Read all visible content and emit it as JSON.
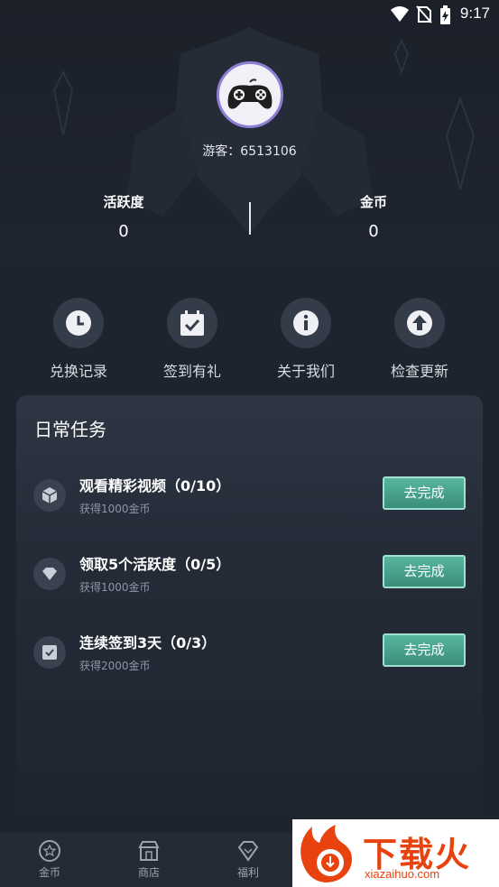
{
  "status_bar": {
    "time": "9:17",
    "icons": [
      "wifi-icon",
      "no-sim-icon",
      "battery-charging-icon"
    ]
  },
  "profile": {
    "avatar_icon": "gamepad-icon",
    "username": "游客：6513106"
  },
  "stats": {
    "activity_label": "活跃度",
    "activity_value": "0",
    "coins_label": "金币",
    "coins_value": "0"
  },
  "quick_actions": [
    {
      "label": "兑换记录",
      "icon": "clock-icon"
    },
    {
      "label": "签到有礼",
      "icon": "calendar-check-icon"
    },
    {
      "label": "关于我们",
      "icon": "info-icon"
    },
    {
      "label": "检查更新",
      "icon": "arrow-up-icon"
    }
  ],
  "daily_tasks": {
    "title": "日常任务",
    "button_label": "去完成",
    "items": [
      {
        "title": "观看精彩视频（0/10）",
        "reward": "获得1000金币",
        "icon": "cube-icon"
      },
      {
        "title": "领取5个活跃度（0/5）",
        "reward": "获得1000金币",
        "icon": "diamond-icon"
      },
      {
        "title": "连续签到3天（0/3）",
        "reward": "获得2000金币",
        "icon": "checkbox-icon"
      }
    ]
  },
  "bottom_nav": [
    {
      "label": "金币",
      "icon": "coin-icon"
    },
    {
      "label": "商店",
      "icon": "shop-icon"
    },
    {
      "label": "福利",
      "icon": "gift-diamond-icon"
    }
  ],
  "watermark": {
    "main": "下载火",
    "sub": "xiazaihuo.com"
  },
  "colors": {
    "background": "#1e242e",
    "card": "#2a313d",
    "button": "#4aa08c",
    "avatar_border": "#8c7fd6"
  }
}
